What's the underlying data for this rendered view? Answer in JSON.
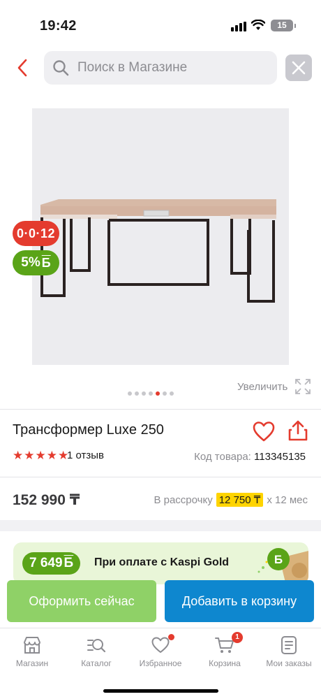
{
  "status_bar": {
    "time": "19:42",
    "battery": "15",
    "icons": [
      "signal-icon",
      "wifi-icon",
      "battery-icon"
    ]
  },
  "header": {
    "back_icon": "chevron-left-icon",
    "search_placeholder": "Поиск в Магазине",
    "search_value": "",
    "clear_icon": "close-icon"
  },
  "product": {
    "image": {
      "description_icon": "product-photo",
      "pagination": {
        "total": 7,
        "active_index": 4
      }
    },
    "badges": {
      "installment": "0·0·12",
      "bonus_value": "5%",
      "bonus_symbol": "Б"
    },
    "zoom_label": "Увеличить",
    "title": "Трансформер Luxe 250",
    "rating": {
      "stars": 5,
      "reviews": "1 отзыв"
    },
    "sku_label": "Код товара:",
    "sku_value": "113345135",
    "price": "152 990 ₸",
    "installment": {
      "prefix": "В рассрочку",
      "amount": "12 750 ₸",
      "suffix": "х 12 мес"
    }
  },
  "promo": {
    "amount": "7 649",
    "symbol": "Б",
    "text": "При оплате с Kaspi Gold"
  },
  "actions": {
    "buy_now": "Оформить сейчас",
    "add_to_cart": "Добавить в корзину"
  },
  "bottom_nav": {
    "items": [
      {
        "label": "Магазин",
        "icon": "store-icon"
      },
      {
        "label": "Каталог",
        "icon": "catalog-search-icon"
      },
      {
        "label": "Избранное",
        "icon": "heart-icon",
        "dot": true
      },
      {
        "label": "Корзина",
        "icon": "cart-icon",
        "count": "1"
      },
      {
        "label": "Мои заказы",
        "icon": "orders-icon"
      }
    ]
  },
  "colors": {
    "accent_red": "#e43b2e",
    "bonus_green": "#5aa418",
    "buy_green": "#8fd167",
    "cart_blue": "#0e87cf",
    "installment_yellow": "#ffd400"
  }
}
